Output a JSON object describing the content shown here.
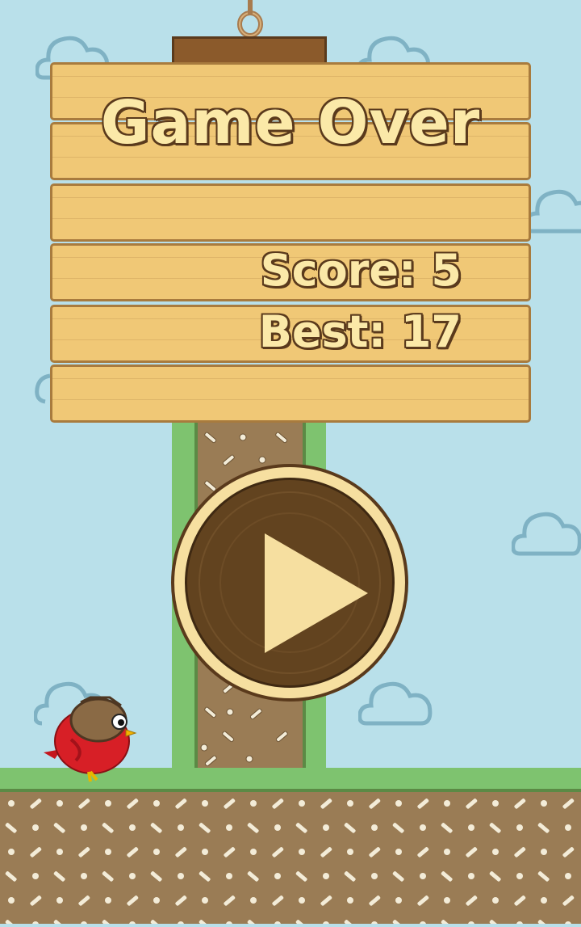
{
  "game": {
    "title": "Game Over",
    "score_label": "Score: 5",
    "best_label": "Best: 17",
    "score": 5,
    "best": 17
  },
  "icons": {
    "play": "play-icon",
    "bird": "red-bird-icon"
  },
  "colors": {
    "sky": "#b9e0ea",
    "grass": "#7ec36f",
    "dirt": "#9a7c55",
    "wood": "#f0c876",
    "dark_wood": "#5a3a1c",
    "text": "#fbe9a8",
    "button_bg": "#62431f"
  }
}
